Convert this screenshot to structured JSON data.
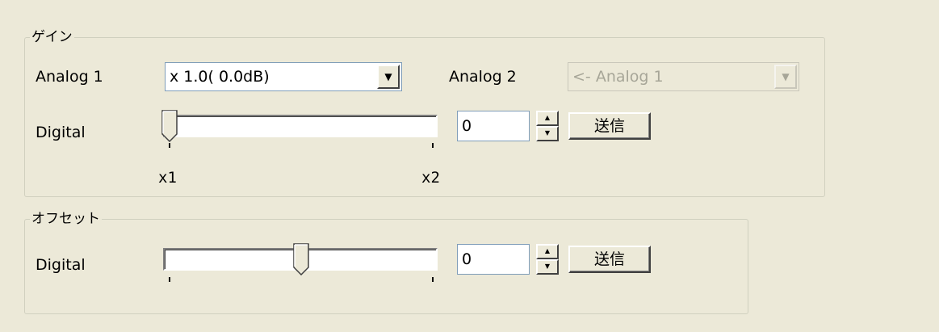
{
  "gain": {
    "title": "ゲイン",
    "analog1_label": "Analog 1",
    "analog1_value": "x 1.0( 0.0dB)",
    "analog2_label": "Analog 2",
    "analog2_value": "<- Analog 1",
    "digital_label": "Digital",
    "slider_value": 0,
    "slider_min_label": "x1",
    "slider_max_label": "x2",
    "spin_value": "0",
    "send_label": "送信"
  },
  "offset": {
    "title": "オフセット",
    "digital_label": "Digital",
    "slider_value": 0.5,
    "spin_value": "0",
    "send_label": "送信"
  },
  "icons": {
    "dropdown_arrow": "chevron-down-icon",
    "spin_up": "up-arrow-icon",
    "spin_down": "down-arrow-icon"
  }
}
